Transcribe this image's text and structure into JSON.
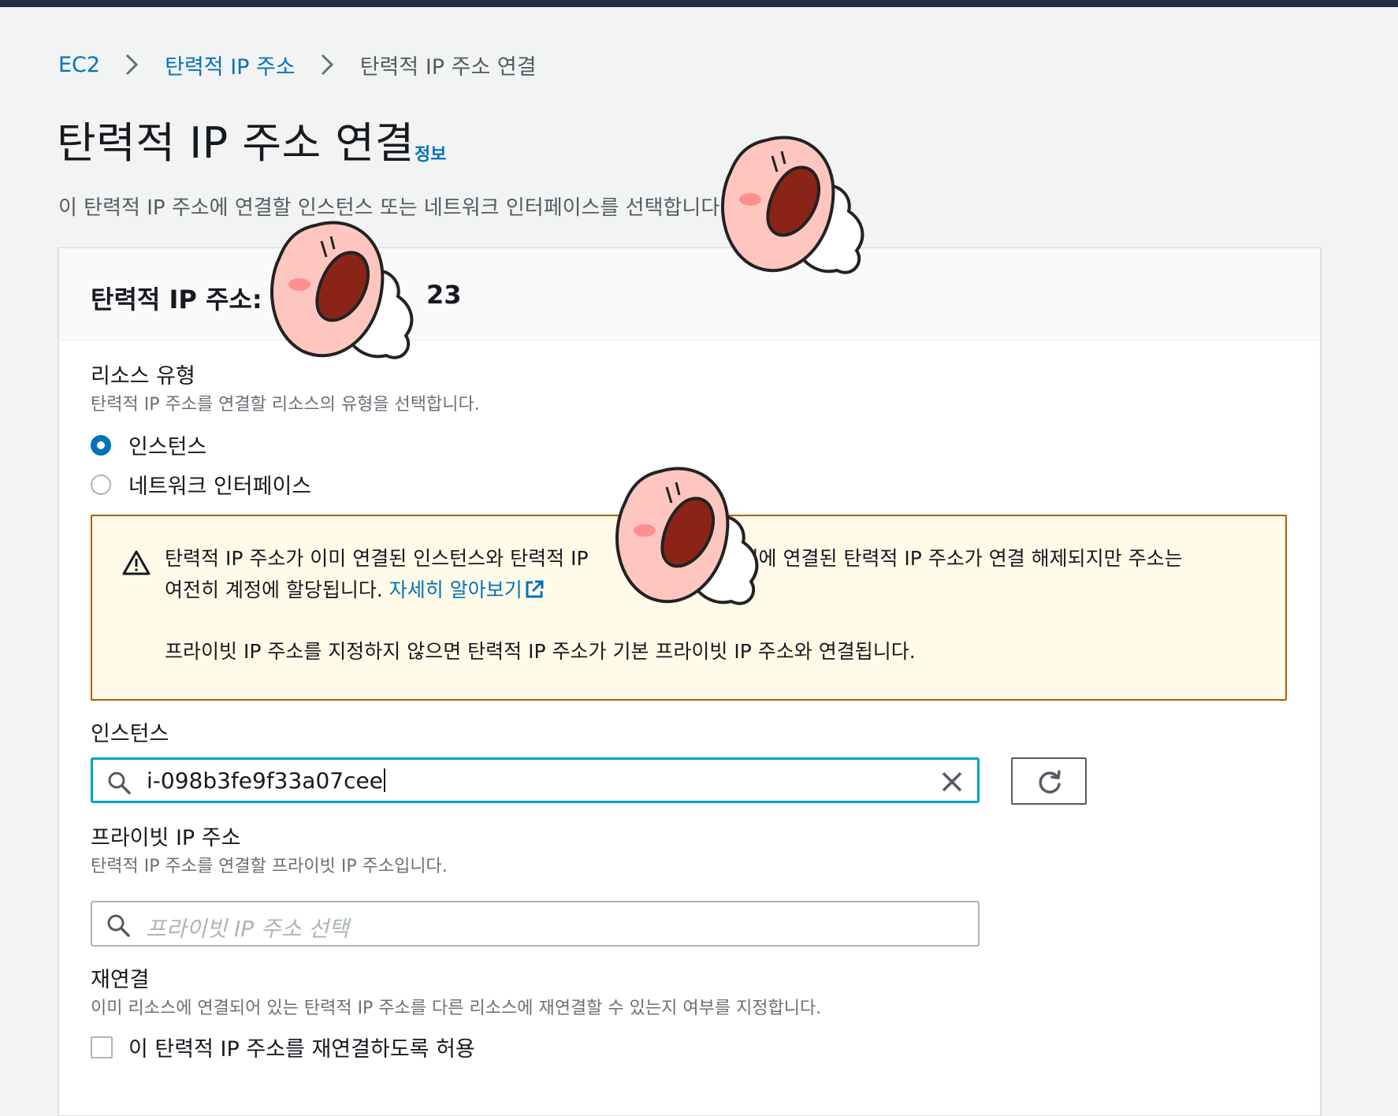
{
  "breadcrumb": {
    "items": [
      "EC2",
      "탄력적 IP 주소"
    ],
    "current": "탄력적 IP 주소 연결"
  },
  "page": {
    "title": "탄력적 IP 주소 연결",
    "info_link": "정보",
    "description": "이 탄력적 IP 주소에 연결할 인스턴스 또는 네트워크 인터페이스를 선택합니다."
  },
  "panel": {
    "title": "탄력적 IP 주소:",
    "title_visible_suffix": "23",
    "resource_type": {
      "label": "리소스 유형",
      "description": "탄력적 IP 주소를 연결할 리소스의 유형을 선택합니다.",
      "options": [
        "인스턴스",
        "네트워크 인터페이스"
      ],
      "selected": "인스턴스"
    },
    "alert": {
      "text_line1_start": "탄력적 IP 주소가 이미 연결된 인스턴스와 탄력적 IP",
      "text_line1_end": "이전에 연결된 탄력적 IP 주소가 연결 해제되지만 주소는",
      "text_line2": "여전히 계정에 할당됩니다.",
      "link": "자세히 알아보기",
      "text_para2": "프라이빗 IP 주소를 지정하지 않으면 탄력적 IP 주소가 기본 프라이빗 IP 주소와 연결됩니다."
    },
    "instance": {
      "label": "인스턴스",
      "value": "i-098b3fe9f33a07cee"
    },
    "private_ip": {
      "label": "프라이빗 IP 주소",
      "description": "탄력적 IP 주소를 연결할 프라이빗 IP 주소입니다.",
      "placeholder": "프라이빗 IP 주소 선택"
    },
    "reassociation": {
      "label": "재연결",
      "description": "이미 리소스에 연결되어 있는 탄력적 IP 주소를 다른 리소스에 재연결할 수 있는지 여부를 지정합니다.",
      "checkbox_label": "이 탄력적 IP 주소를 재연결하도록 허용",
      "checked": false
    }
  },
  "colors": {
    "link": "#0073bb",
    "focus": "#00a1c9",
    "warning_border": "#ad5f00",
    "warning_bg": "#fffbe8"
  }
}
